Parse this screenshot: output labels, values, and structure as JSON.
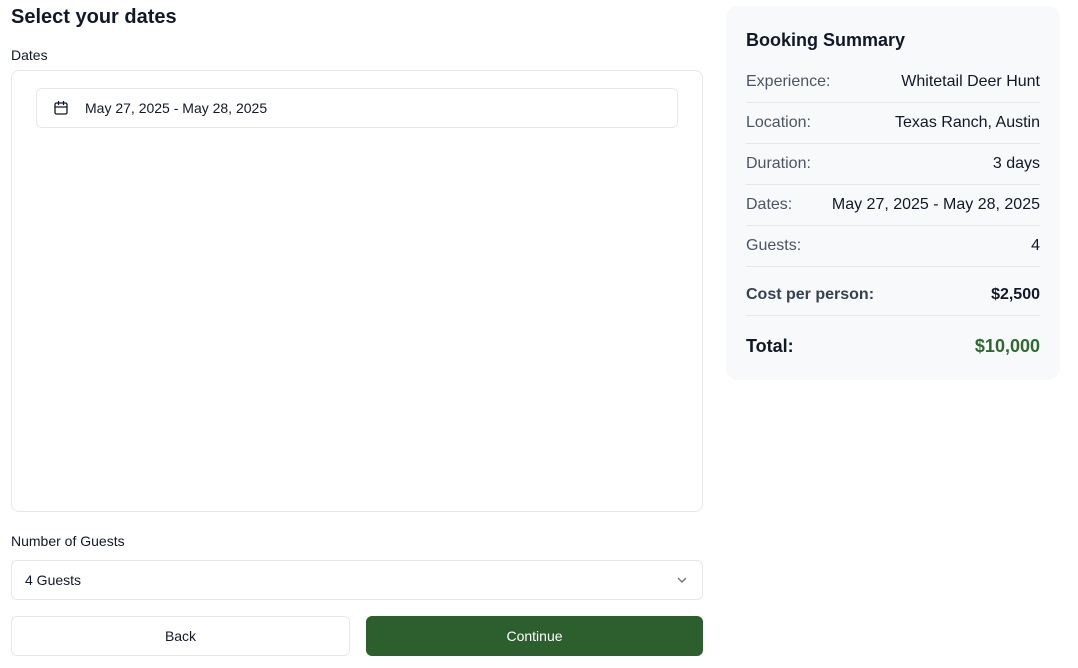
{
  "page": {
    "title": "Select your dates"
  },
  "dates": {
    "label": "Dates",
    "range_value": "May 27, 2025 - May 28, 2025",
    "icon": "calendar-icon"
  },
  "guests": {
    "label": "Number of Guests",
    "selected": "4 Guests",
    "icon": "chevron-down-icon"
  },
  "actions": {
    "back_label": "Back",
    "continue_label": "Continue"
  },
  "summary": {
    "title": "Booking Summary",
    "experience_label": "Experience:",
    "experience_value": "Whitetail Deer Hunt",
    "location_label": "Location:",
    "location_value": "Texas Ranch, Austin",
    "duration_label": "Duration:",
    "duration_value": "3 days",
    "dates_label": "Dates:",
    "dates_value": "May 27, 2025 - May 28, 2025",
    "guests_label": "Guests:",
    "guests_value": "4",
    "cost_label": "Cost per person:",
    "cost_value": "$2,500",
    "total_label": "Total:",
    "total_value": "$10,000"
  },
  "colors": {
    "primary": "#2d5e2e",
    "total_accent": "#2d6a2f",
    "summary_bg": "#f8f9fa",
    "border": "#e5e7eb"
  }
}
